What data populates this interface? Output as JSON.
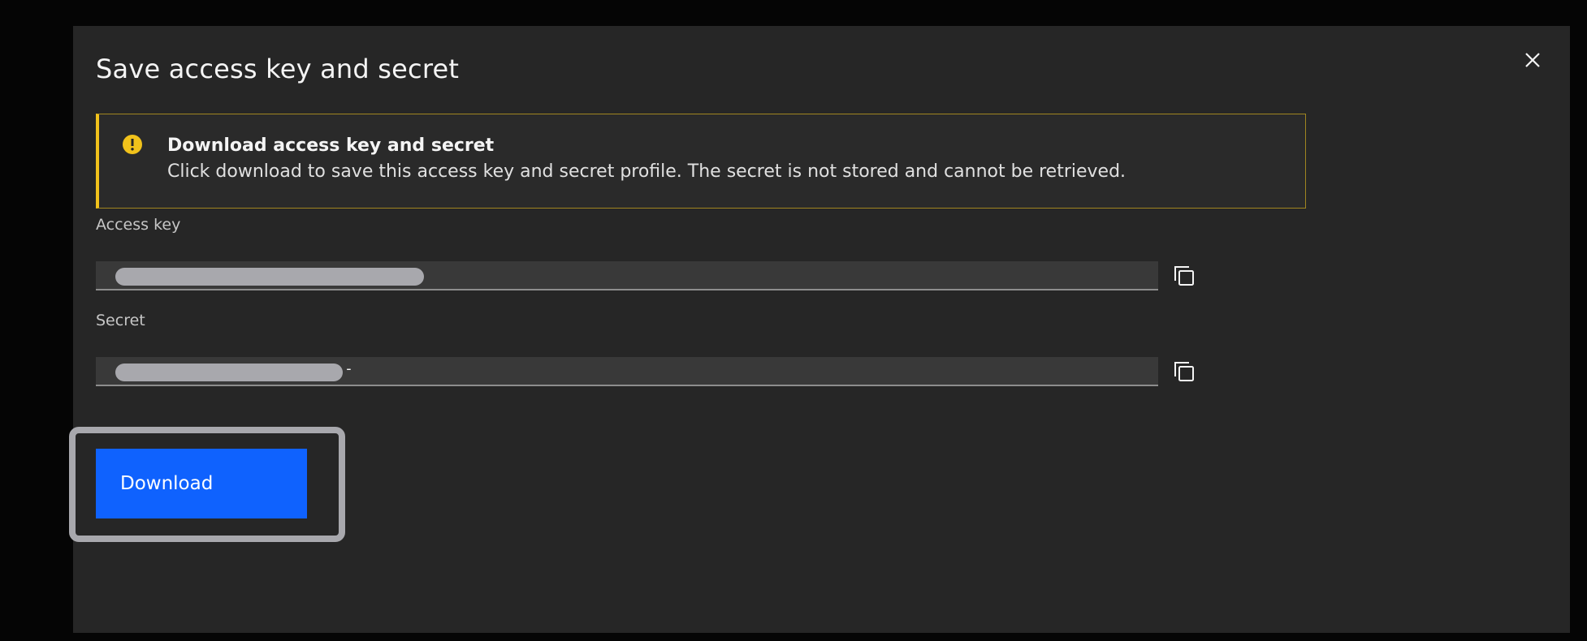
{
  "modal": {
    "title": "Save access key and secret"
  },
  "notification": {
    "kind": "warning",
    "icon": "warning-icon",
    "title": "Download access key and secret",
    "body": "Click download to save this access key and secret profile. The secret is not stored and cannot be retrieved."
  },
  "access_key": {
    "label": "Access key",
    "value": ""
  },
  "secret": {
    "label": "Secret",
    "value": "-"
  },
  "actions": {
    "download_label": "Download"
  },
  "colors": {
    "primary_button": "#0f62fe",
    "warning_accent": "#f1c21b",
    "modal_bg": "#262626"
  }
}
